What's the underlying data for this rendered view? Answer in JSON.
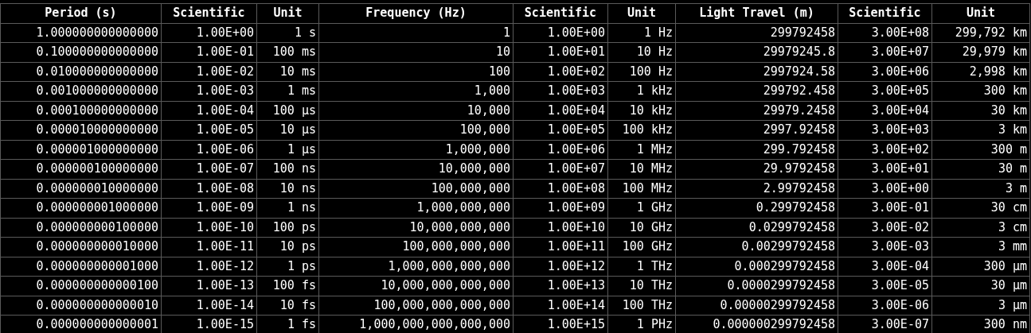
{
  "table": {
    "columns": [
      "Period (s)",
      "Scientific",
      "Unit",
      "Frequency (Hz)",
      "Scientific",
      "Unit",
      "Light Travel (m)",
      "Scientific",
      "Unit"
    ],
    "rows": [
      [
        "1.000000000000000",
        "1.00E+00",
        "1 s",
        "1",
        "1.00E+00",
        "1 Hz",
        "299792458",
        "3.00E+08",
        "299,792 km"
      ],
      [
        "0.100000000000000",
        "1.00E-01",
        "100 ms",
        "10",
        "1.00E+01",
        "10 Hz",
        "29979245.8",
        "3.00E+07",
        "29,979 km"
      ],
      [
        "0.010000000000000",
        "1.00E-02",
        "10 ms",
        "100",
        "1.00E+02",
        "100 Hz",
        "2997924.58",
        "3.00E+06",
        "2,998 km"
      ],
      [
        "0.001000000000000",
        "1.00E-03",
        "1 ms",
        "1,000",
        "1.00E+03",
        "1 kHz",
        "299792.458",
        "3.00E+05",
        "300 km"
      ],
      [
        "0.000100000000000",
        "1.00E-04",
        "100 µs",
        "10,000",
        "1.00E+04",
        "10 kHz",
        "29979.2458",
        "3.00E+04",
        "30 km"
      ],
      [
        "0.000010000000000",
        "1.00E-05",
        "10 µs",
        "100,000",
        "1.00E+05",
        "100 kHz",
        "2997.92458",
        "3.00E+03",
        "3 km"
      ],
      [
        "0.000001000000000",
        "1.00E-06",
        "1 µs",
        "1,000,000",
        "1.00E+06",
        "1 MHz",
        "299.792458",
        "3.00E+02",
        "300 m"
      ],
      [
        "0.000000100000000",
        "1.00E-07",
        "100 ns",
        "10,000,000",
        "1.00E+07",
        "10 MHz",
        "29.9792458",
        "3.00E+01",
        "30 m"
      ],
      [
        "0.000000010000000",
        "1.00E-08",
        "10 ns",
        "100,000,000",
        "1.00E+08",
        "100 MHz",
        "2.99792458",
        "3.00E+00",
        "3 m"
      ],
      [
        "0.000000001000000",
        "1.00E-09",
        "1 ns",
        "1,000,000,000",
        "1.00E+09",
        "1 GHz",
        "0.299792458",
        "3.00E-01",
        "30 cm"
      ],
      [
        "0.000000000100000",
        "1.00E-10",
        "100 ps",
        "10,000,000,000",
        "1.00E+10",
        "10 GHz",
        "0.0299792458",
        "3.00E-02",
        "3 cm"
      ],
      [
        "0.000000000010000",
        "1.00E-11",
        "10 ps",
        "100,000,000,000",
        "1.00E+11",
        "100 GHz",
        "0.00299792458",
        "3.00E-03",
        "3 mm"
      ],
      [
        "0.000000000001000",
        "1.00E-12",
        "1 ps",
        "1,000,000,000,000",
        "1.00E+12",
        "1 THz",
        "0.000299792458",
        "3.00E-04",
        "300 µm"
      ],
      [
        "0.000000000000100",
        "1.00E-13",
        "100 fs",
        "10,000,000,000,000",
        "1.00E+13",
        "10 THz",
        "0.0000299792458",
        "3.00E-05",
        "30 µm"
      ],
      [
        "0.000000000000010",
        "1.00E-14",
        "10 fs",
        "100,000,000,000,000",
        "1.00E+14",
        "100 THz",
        "0.00000299792458",
        "3.00E-06",
        "3 µm"
      ],
      [
        "0.000000000000001",
        "1.00E-15",
        "1 fs",
        "1,000,000,000,000,000",
        "1.00E+15",
        "1 PHz",
        "0.000000299792458",
        "3.00E-07",
        "300 nm"
      ]
    ]
  }
}
